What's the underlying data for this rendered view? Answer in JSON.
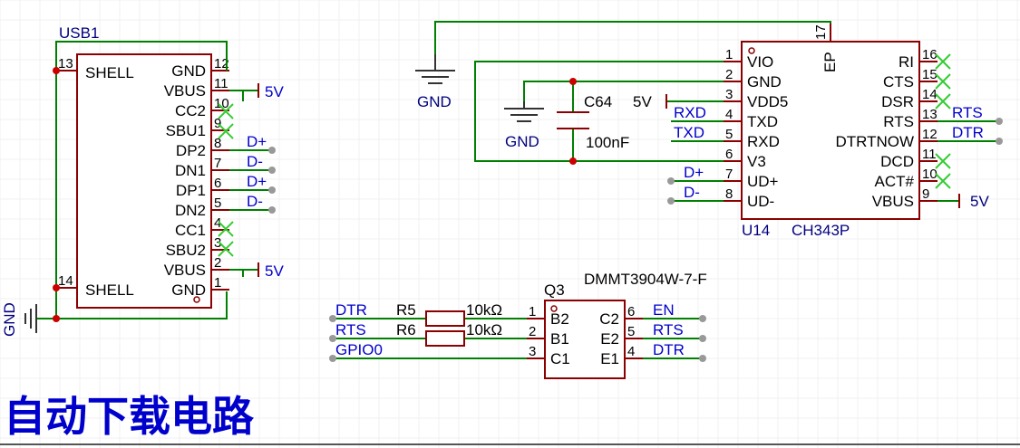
{
  "usb": {
    "ref": "USB1",
    "left_pins": [
      {
        "num": "13",
        "name": "SHELL"
      },
      {
        "num": "14",
        "name": "SHELL"
      }
    ],
    "right_pins": [
      {
        "num": "12",
        "name": "GND"
      },
      {
        "num": "11",
        "name": "VBUS"
      },
      {
        "num": "10",
        "name": "CC2"
      },
      {
        "num": "9",
        "name": "SBU1"
      },
      {
        "num": "8",
        "name": "DP2"
      },
      {
        "num": "7",
        "name": "DN1"
      },
      {
        "num": "6",
        "name": "DP1"
      },
      {
        "num": "5",
        "name": "DN2"
      },
      {
        "num": "4",
        "name": "CC1"
      },
      {
        "num": "3",
        "name": "SBU2"
      },
      {
        "num": "2",
        "name": "VBUS"
      },
      {
        "num": "1",
        "name": "GND"
      }
    ],
    "nets": {
      "vbus_top": "5V",
      "dp2": "D+",
      "dn1": "D-",
      "dp1": "D+",
      "dn2": "D-",
      "vbus_bottom": "5V",
      "gnd": "GND"
    }
  },
  "ch343": {
    "ref": "U14",
    "value": "CH343P",
    "left_pins": [
      {
        "num": "1",
        "name": "VIO"
      },
      {
        "num": "2",
        "name": "GND"
      },
      {
        "num": "3",
        "name": "VDD5"
      },
      {
        "num": "4",
        "name": "TXD"
      },
      {
        "num": "5",
        "name": "RXD"
      },
      {
        "num": "6",
        "name": "V3"
      },
      {
        "num": "7",
        "name": "UD+"
      },
      {
        "num": "8",
        "name": "UD-"
      }
    ],
    "right_pins": [
      {
        "num": "16",
        "name": "RI"
      },
      {
        "num": "15",
        "name": "CTS"
      },
      {
        "num": "14",
        "name": "DSR"
      },
      {
        "num": "13",
        "name": "RTS"
      },
      {
        "num": "12",
        "name": "DTRTNOW"
      },
      {
        "num": "11",
        "name": "DCD"
      },
      {
        "num": "10",
        "name": "ACT#"
      },
      {
        "num": "9",
        "name": "VBUS"
      }
    ],
    "top_pin": {
      "num": "17",
      "name": "EP"
    },
    "nets": {
      "gnd_top": "GND",
      "gnd_cap": "GND",
      "vdd5": "5V",
      "rxd": "RXD",
      "txd": "TXD",
      "udp": "D+",
      "udm": "D-",
      "rts": "RTS",
      "dtr": "DTR",
      "vbus": "5V"
    }
  },
  "cap": {
    "ref": "C64",
    "value": "100nF"
  },
  "q3": {
    "ref": "Q3",
    "value": "DMMT3904W-7-F",
    "left_pins": [
      {
        "num": "1",
        "name": "B2"
      },
      {
        "num": "2",
        "name": "B1"
      },
      {
        "num": "3",
        "name": "C1"
      }
    ],
    "right_pins": [
      {
        "num": "6",
        "name": "C2"
      },
      {
        "num": "5",
        "name": "E2"
      },
      {
        "num": "4",
        "name": "E1"
      }
    ],
    "left_nets": [
      "DTR",
      "RTS",
      "GPIO0"
    ],
    "right_nets": [
      "EN",
      "RTS",
      "DTR"
    ],
    "resistors": [
      {
        "ref": "R5",
        "value": "10kΩ"
      },
      {
        "ref": "R6",
        "value": "10kΩ"
      }
    ]
  },
  "title": "自动下载电路",
  "colors": {
    "wire": "#008000",
    "body": "#8b0000",
    "net_label": "#0000cc",
    "ref": "#000080",
    "junction": "#cc0000",
    "noconnect": "#33cc33"
  }
}
